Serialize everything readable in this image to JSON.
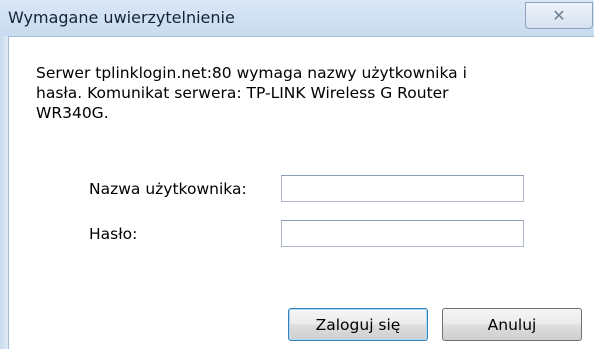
{
  "window": {
    "title": "Wymagane uwierzytelnienie",
    "close_icon": "close-icon"
  },
  "dialog": {
    "message": "Serwer tplinklogin.net:80 wymaga nazwy użytkownika i hasła. Komunikat serwera: TP-LINK Wireless G Router WR340G.",
    "username_label": "Nazwa użytkownika:",
    "username_value": "",
    "password_label": "Hasło:",
    "password_value": "",
    "login_button": "Zaloguj się",
    "cancel_button": "Anuluj"
  },
  "colors": {
    "titlebar": "#c9dbef",
    "default_button_border": "#3c7fb1"
  }
}
